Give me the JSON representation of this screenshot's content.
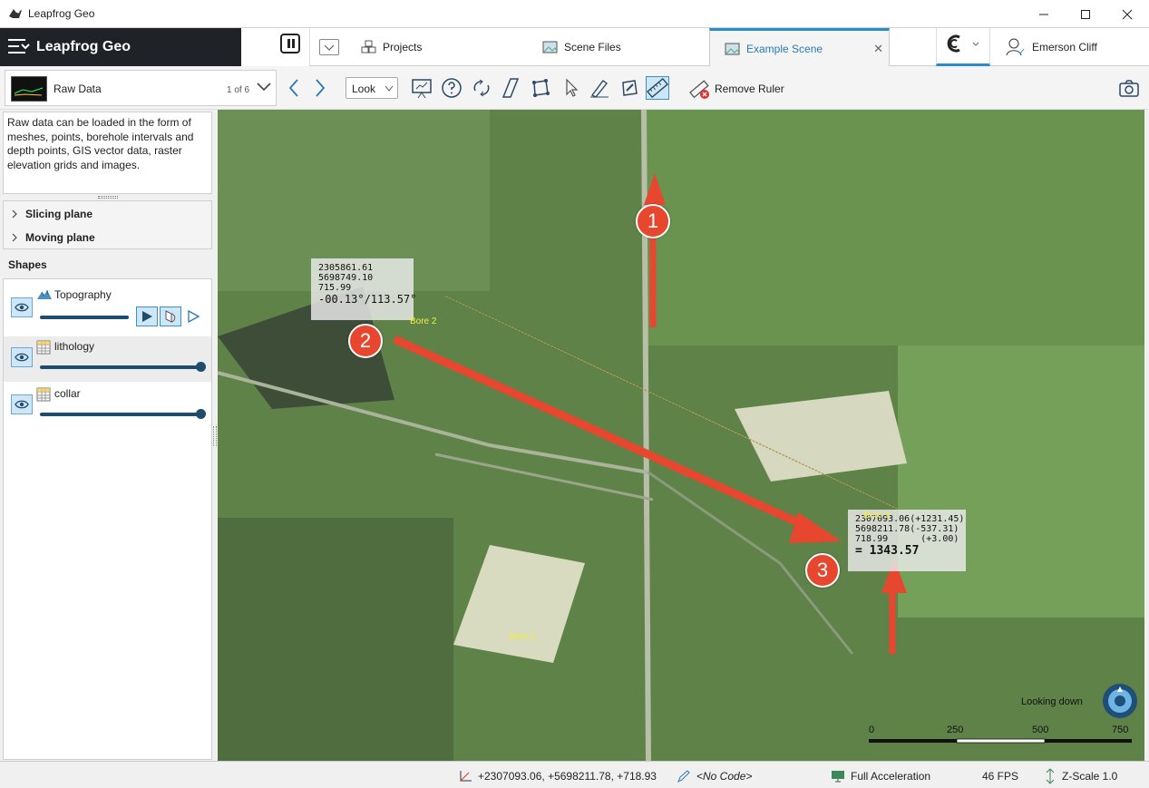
{
  "window": {
    "title": "Leapfrog Geo"
  },
  "nav": {
    "brand": "Leapfrog Geo",
    "tabs": [
      {
        "label": "Projects"
      },
      {
        "label": "Scene Files"
      },
      {
        "label": "Example Scene"
      }
    ],
    "user": "Emerson Cliff"
  },
  "toolbar": {
    "scene_label": "Raw Data",
    "scene_count": "1 of 6",
    "look_value": "Look",
    "remove_ruler_label": "Remove Ruler"
  },
  "sidebar": {
    "description": "Raw data can be loaded in the form of meshes, points, borehole intervals and depth points, GIS vector data, raster elevation grids and images.",
    "planes": [
      {
        "label": "Slicing plane"
      },
      {
        "label": "Moving plane"
      }
    ],
    "shapes_header": "Shapes",
    "shapes": [
      {
        "name": "Topography",
        "slider": 0.68
      },
      {
        "name": "lithology",
        "slider": 1.0
      },
      {
        "name": "collar",
        "slider": 1.0
      }
    ]
  },
  "viewport": {
    "readout_start": {
      "line1": "2305861.61",
      "line2": "5698749.10",
      "line3": "715.99",
      "angle": "-00.13°/113.57°"
    },
    "readout_end": {
      "line1": "2307093.06(+1231.45)",
      "line2": "5698211.78(-537.31)",
      "line3": "718.99      (+3.00)",
      "distance": "= 1343.57"
    },
    "map_labels": [
      "Bore 2",
      "Bore 3",
      "Bore 1"
    ],
    "markers": [
      "1",
      "2",
      "3"
    ],
    "looking": "Looking down",
    "scale_ticks": [
      "0",
      "250",
      "500",
      "750"
    ]
  },
  "status": {
    "coords": "+2307093.06, +5698211.78, +718.93",
    "code": "<No Code>",
    "accel": "Full Acceleration",
    "fps": "46 FPS",
    "zscale": "Z-Scale 1.0"
  },
  "colors": {
    "accent": "#2a8bc9",
    "marker": "#e8472f",
    "brand_bg": "#1f2227"
  }
}
